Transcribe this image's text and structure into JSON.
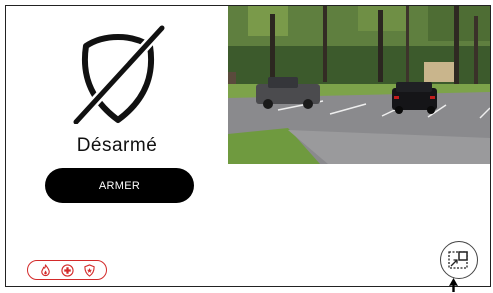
{
  "security": {
    "status_label": "Désarmé",
    "arm_button_label": "ARMER",
    "shield_icon": "shield-off-icon"
  },
  "panic": {
    "buttons": [
      {
        "name": "fire",
        "icon": "flame-icon"
      },
      {
        "name": "medical",
        "icon": "medical-cross-icon"
      },
      {
        "name": "police",
        "icon": "police-badge-icon"
      }
    ],
    "color": "#d32a2a"
  },
  "camera": {
    "scene": "parking-lot-live-view"
  },
  "controls": {
    "expand_icon": "expand-view-icon"
  }
}
